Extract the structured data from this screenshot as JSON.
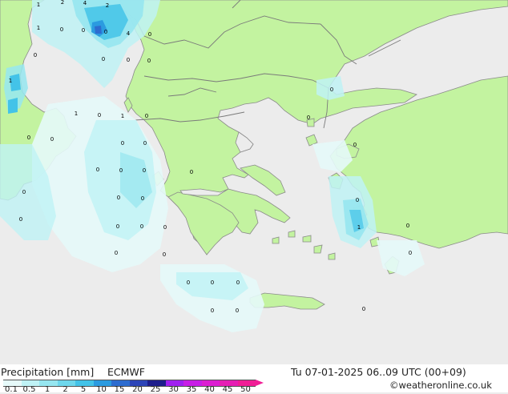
{
  "footer": {
    "product_label": "Precipitation [mm]",
    "model_label": "ECMWF",
    "datetime": "Tu 07-01-2025 06..09 UTC (00+09)",
    "credit": "©weatheronline.co.uk"
  },
  "legend": {
    "labels": [
      "0.1",
      "0.5",
      "1",
      "2",
      "5",
      "10",
      "15",
      "20",
      "25",
      "30",
      "35",
      "40",
      "45",
      "50"
    ],
    "colors": [
      "#e6fafa",
      "#bff2f5",
      "#96e6f0",
      "#6ed7ec",
      "#43c3e8",
      "#2b9be0",
      "#2d6ccf",
      "#2d45b8",
      "#1e1e8c",
      "#a020f0",
      "#c81ee6",
      "#dc1ed2",
      "#e61eb4",
      "#f01e96"
    ]
  },
  "map": {
    "colors": {
      "sea": "#ececec",
      "land": "#c3f3a0",
      "border": "#7a7a7a",
      "coast": "#8a8a8a"
    },
    "values": [
      "1",
      "2",
      "4",
      "2",
      "1",
      "0",
      "0",
      "0",
      "4",
      "0",
      "0",
      "0",
      "0",
      "0",
      "1",
      "1",
      "0",
      "1",
      "0",
      "0",
      "0",
      "0",
      "0",
      "0",
      "0",
      "0",
      "0",
      "0",
      "0",
      "0",
      "0",
      "0",
      "0",
      "0",
      "0",
      "0",
      "0",
      "0",
      "0",
      "0",
      "0",
      "0",
      "1",
      "0",
      "0",
      "0",
      "0",
      "0",
      "0"
    ]
  }
}
